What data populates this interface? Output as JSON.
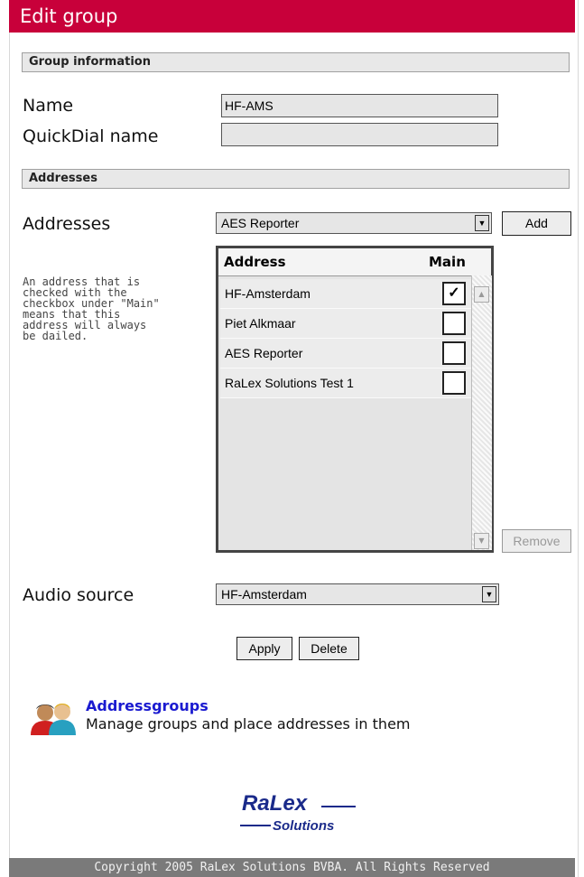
{
  "title": "Edit group",
  "group_info": {
    "section_title": "Group information",
    "name_label": "Name",
    "name_value": "HF-AMS",
    "quickdial_label": "QuickDial name",
    "quickdial_value": ""
  },
  "addresses": {
    "section_title": "Addresses",
    "label": "Addresses",
    "selected": "AES Reporter",
    "add_button": "Add",
    "help_text": "An address that is\nchecked with the\ncheckbox under \"Main\"\nmeans that this\naddress will always\nbe dailed.",
    "list": {
      "col_address": "Address",
      "col_main": "Main",
      "rows": [
        {
          "address": "HF-Amsterdam",
          "main": true
        },
        {
          "address": "Piet Alkmaar",
          "main": false
        },
        {
          "address": "AES Reporter",
          "main": false
        },
        {
          "address": "RaLex Solutions Test 1",
          "main": false
        }
      ]
    },
    "remove_button": "Remove"
  },
  "audio": {
    "label": "Audio source",
    "selected": "HF-Amsterdam"
  },
  "actions": {
    "apply": "Apply",
    "delete": "Delete"
  },
  "nav": {
    "title": "Addressgroups",
    "desc": "Manage groups and place addresses in them",
    "icon": "users-icon"
  },
  "logo": {
    "line1": "RaLex",
    "line2": "Solutions"
  },
  "footer": "Copyright 2005 RaLex Solutions BVBA. All Rights Reserved",
  "colors": {
    "titlebar": "#c8003a",
    "link": "#1a1ad0",
    "logo": "#1a2a8a",
    "footer_bg": "#7a7a7a"
  }
}
